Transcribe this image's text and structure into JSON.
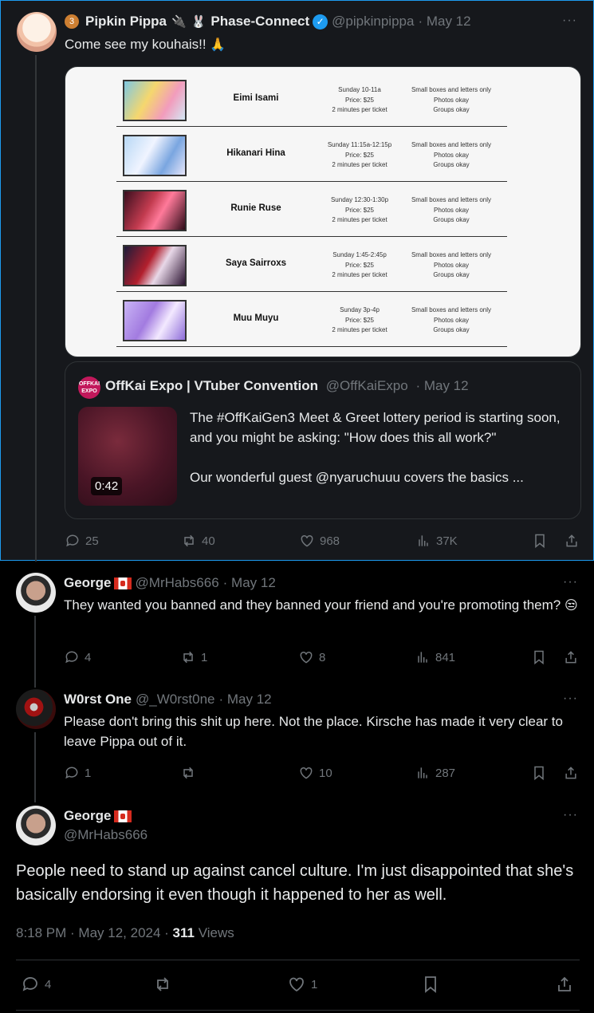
{
  "main_tweet": {
    "author_name": "Pipkin Pippa",
    "badge_icon": "bronze-badge",
    "author_suffix": "Phase-Connect",
    "handle": "@pipkinpippa",
    "date": "· May 12",
    "text": "Come see my kouhais!!",
    "text_emoji": "🙏",
    "schedule": [
      {
        "name": "Eimi Isami",
        "time": "Sunday 10-11a",
        "price": "Price: $25",
        "duration": "2 minutes per ticket",
        "rule1": "Small boxes and letters only",
        "rule2": "Photos okay",
        "rule3": "Groups okay"
      },
      {
        "name": "Hikanari Hina",
        "time": "Sunday 11:15a-12:15p",
        "price": "Price: $25",
        "duration": "2 minutes per ticket",
        "rule1": "Small boxes and letters only",
        "rule2": "Photos okay",
        "rule3": "Groups okay"
      },
      {
        "name": "Runie Ruse",
        "time": "Sunday 12:30-1:30p",
        "price": "Price: $25",
        "duration": "2 minutes per ticket",
        "rule1": "Small boxes and letters only",
        "rule2": "Photos okay",
        "rule3": "Groups okay"
      },
      {
        "name": "Saya Sairroxs",
        "time": "Sunday 1:45-2:45p",
        "price": "Price: $25",
        "duration": "2 minutes per ticket",
        "rule1": "Small boxes and letters only",
        "rule2": "Photos okay",
        "rule3": "Groups okay"
      },
      {
        "name": "Muu Muyu",
        "time": "Sunday 3p-4p",
        "price": "Price: $25",
        "duration": "2 minutes per ticket",
        "rule1": "Small boxes and letters only",
        "rule2": "Photos okay",
        "rule3": "Groups okay"
      }
    ],
    "quote": {
      "logo_text": "OFFKAI EXPO",
      "name": "OffKai Expo | VTuber Convention",
      "handle": "@OffKaiExpo",
      "date": "· May 12",
      "duration": "0:42",
      "text1": "The #OffKaiGen3 Meet & Greet lottery period is starting soon, and you might be asking: \"How does this all work?\"",
      "text2": "Our wonderful guest @nyaruchuuu covers the basics ..."
    },
    "stats": {
      "replies": "25",
      "reposts": "40",
      "likes": "968",
      "views": "37K"
    }
  },
  "reply1": {
    "author_name": "George",
    "handle": "@MrHabs666",
    "date": "· May 12",
    "text": "They wanted you banned and they banned your friend and you're promoting them?",
    "text_emoji": "😒",
    "stats": {
      "replies": "4",
      "reposts": "1",
      "likes": "8",
      "views": "841"
    }
  },
  "reply2": {
    "author_name": "W0rst One",
    "handle": "@_W0rst0ne",
    "date": "· May 12",
    "text": "Please don't bring this shit up here. Not the place. Kirsche has made it very clear to leave Pippa out of it.",
    "stats": {
      "replies": "1",
      "reposts": "",
      "likes": "10",
      "views": "287"
    }
  },
  "focused": {
    "author_name": "George",
    "handle": "@MrHabs666",
    "text": "People need to stand up against cancel culture. I'm just disappointed that she's basically endorsing it even though it happened to her as well.",
    "time": "8:18 PM · May 12, 2024 · ",
    "views_count": "311",
    "views_label": " Views",
    "stats": {
      "replies": "4",
      "reposts": "",
      "likes": "1"
    }
  },
  "more_icon": "···"
}
